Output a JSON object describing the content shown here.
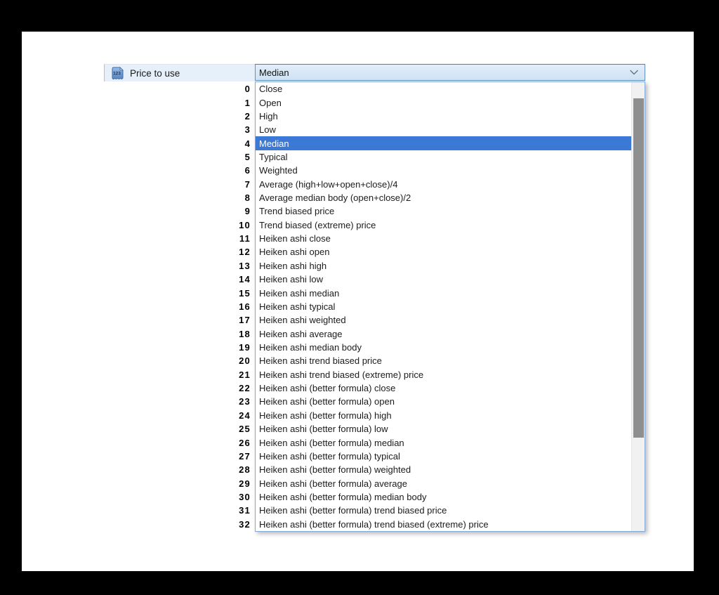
{
  "parameter": {
    "label": "Price to use",
    "icon": "numeric-123-icon"
  },
  "dropdown": {
    "selected_value": "Median",
    "selected_index": 4,
    "options": [
      {
        "id": "0",
        "label": "Close"
      },
      {
        "id": "1",
        "label": "Open"
      },
      {
        "id": "2",
        "label": "High"
      },
      {
        "id": "3",
        "label": "Low"
      },
      {
        "id": "4",
        "label": "Median",
        "selected": true
      },
      {
        "id": "5",
        "label": "Typical"
      },
      {
        "id": "6",
        "label": "Weighted"
      },
      {
        "id": "7",
        "label": "Average (high+low+open+close)/4"
      },
      {
        "id": "8",
        "label": "Average median body (open+close)/2"
      },
      {
        "id": "9",
        "label": "Trend biased price"
      },
      {
        "id": "10",
        "label": "Trend biased (extreme) price"
      },
      {
        "id": "11",
        "label": "Heiken ashi close"
      },
      {
        "id": "12",
        "label": "Heiken ashi open"
      },
      {
        "id": "13",
        "label": "Heiken ashi high"
      },
      {
        "id": "14",
        "label": "Heiken ashi low"
      },
      {
        "id": "15",
        "label": "Heiken ashi median"
      },
      {
        "id": "16",
        "label": "Heiken ashi typical"
      },
      {
        "id": "17",
        "label": "Heiken ashi weighted"
      },
      {
        "id": "18",
        "label": "Heiken ashi average"
      },
      {
        "id": "19",
        "label": "Heiken ashi median body"
      },
      {
        "id": "20",
        "label": "Heiken ashi trend biased price"
      },
      {
        "id": "21",
        "label": "Heiken ashi trend biased (extreme) price"
      },
      {
        "id": "22",
        "label": "Heiken ashi (better formula) close"
      },
      {
        "id": "23",
        "label": "Heiken ashi (better formula) open"
      },
      {
        "id": "24",
        "label": "Heiken ashi (better formula) high"
      },
      {
        "id": "25",
        "label": "Heiken ashi (better formula) low"
      },
      {
        "id": "26",
        "label": "Heiken ashi (better formula) median"
      },
      {
        "id": "27",
        "label": "Heiken ashi (better formula) typical"
      },
      {
        "id": "28",
        "label": "Heiken ashi (better formula) weighted"
      },
      {
        "id": "29",
        "label": "Heiken ashi (better formula) average"
      },
      {
        "id": "30",
        "label": "Heiken ashi (better formula) median body"
      },
      {
        "id": "31",
        "label": "Heiken ashi (better formula) trend biased price"
      },
      {
        "id": "32",
        "label": "Heiken ashi (better formula) trend biased (extreme) price"
      }
    ]
  },
  "colors": {
    "selection_highlight": "#3c78d5",
    "combo_background": "#d6e6f7",
    "combo_border": "#6292c4",
    "list_border": "#82a9d9",
    "param_row_background": "#e6f0fb",
    "scroll_thumb": "#8f8f8f",
    "scroll_track": "#f1f1f1"
  }
}
